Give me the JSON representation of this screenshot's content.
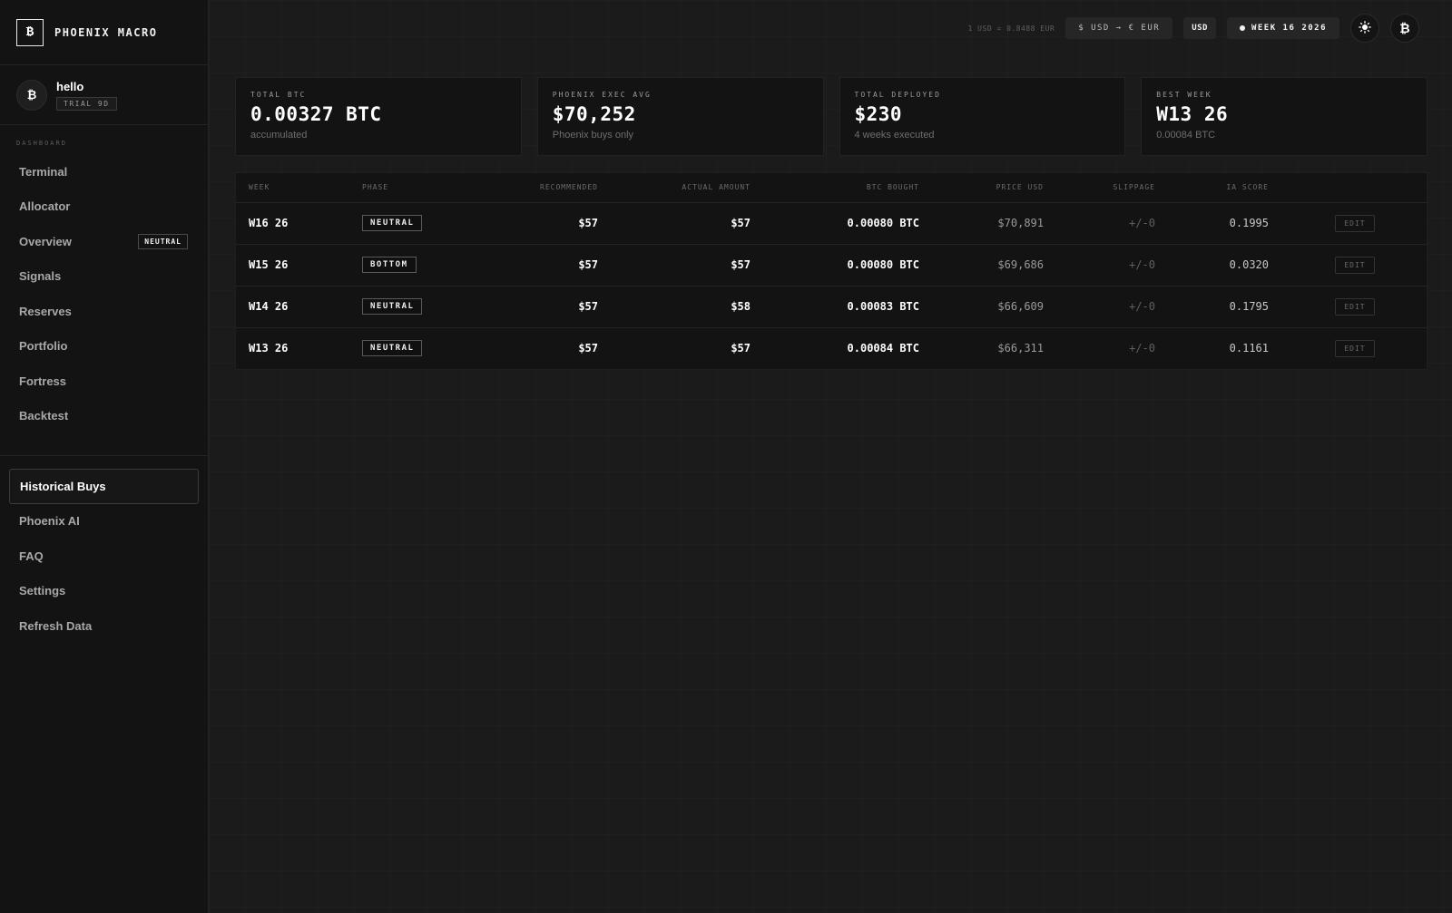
{
  "brand": {
    "logo": "₿",
    "name": "PHOENIX MACRO"
  },
  "user": {
    "avatar": "₿",
    "name": "hello",
    "trial": "TRIAL 9D"
  },
  "sidebar": {
    "section_label": "DASHBOARD",
    "items": [
      {
        "label": "Terminal"
      },
      {
        "label": "Allocator"
      },
      {
        "label": "Overview",
        "badge": "NEUTRAL"
      },
      {
        "label": "Signals"
      },
      {
        "label": "Reserves"
      },
      {
        "label": "Portfolio"
      },
      {
        "label": "Fortress"
      },
      {
        "label": "Backtest"
      }
    ],
    "secondary": [
      {
        "label": "Historical Buys",
        "active": true
      },
      {
        "label": "Phoenix AI"
      },
      {
        "label": "FAQ"
      },
      {
        "label": "Settings"
      },
      {
        "label": "Refresh Data"
      }
    ]
  },
  "topbar": {
    "fx_rate": "1 USD = 0.8488 EUR",
    "convert": "$ USD → € EUR",
    "currency": "USD",
    "week": "WEEK 16 2026",
    "theme_icon": "sun-icon",
    "btc_icon": "₿"
  },
  "cards": [
    {
      "label": "TOTAL BTC",
      "value": "0.00327 BTC",
      "sub": "accumulated"
    },
    {
      "label": "PHOENIX EXEC AVG",
      "value": "$70,252",
      "sub": "Phoenix buys only"
    },
    {
      "label": "TOTAL DEPLOYED",
      "value": "$230",
      "sub": "4 weeks executed"
    },
    {
      "label": "BEST WEEK",
      "value": "W13 26",
      "sub": "0.00084 BTC"
    }
  ],
  "table": {
    "headers": {
      "week": "WEEK",
      "phase": "PHASE",
      "recommended": "RECOMMENDED",
      "actual": "ACTUAL AMOUNT",
      "btc": "BTC BOUGHT",
      "price": "PRICE USD",
      "slippage": "SLIPPAGE",
      "score": "IA SCORE"
    },
    "edit_label": "EDIT",
    "rows": [
      {
        "week": "W16 26",
        "phase": "NEUTRAL",
        "recommended": "$57",
        "actual": "$57",
        "btc": "0.00080 BTC",
        "price": "$70,891",
        "slippage": "+/-0",
        "score": "0.1995"
      },
      {
        "week": "W15 26",
        "phase": "BOTTOM",
        "recommended": "$57",
        "actual": "$57",
        "btc": "0.00080 BTC",
        "price": "$69,686",
        "slippage": "+/-0",
        "score": "0.0320"
      },
      {
        "week": "W14 26",
        "phase": "NEUTRAL",
        "recommended": "$57",
        "actual": "$58",
        "btc": "0.00083 BTC",
        "price": "$66,609",
        "slippage": "+/-0",
        "score": "0.1795"
      },
      {
        "week": "W13 26",
        "phase": "NEUTRAL",
        "recommended": "$57",
        "actual": "$57",
        "btc": "0.00084 BTC",
        "price": "$66,311",
        "slippage": "+/-0",
        "score": "0.1161"
      }
    ]
  }
}
